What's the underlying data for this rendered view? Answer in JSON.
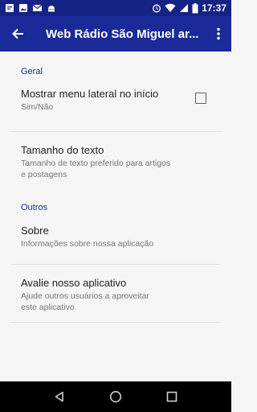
{
  "status_bar": {
    "time": "17:37",
    "left_icons": [
      "notification-icon",
      "image-icon",
      "email-icon",
      "android-icon"
    ],
    "right_icons": [
      "alarm-icon",
      "wifi-icon",
      "signal-icon",
      "battery-icon"
    ]
  },
  "app_bar": {
    "title": "Web Rádio São Miguel ar...",
    "back_icon": "arrow-back-icon",
    "menu_icon": "more-vert-icon"
  },
  "sections": [
    {
      "header": "Geral",
      "items": [
        {
          "title": "Mostrar menu lateral no início",
          "summary": "Sim/Não",
          "has_checkbox": true,
          "checked": false
        },
        {
          "title": "Tamanho do texto",
          "summary_line1": "Tamanho de texto preferido para artigos",
          "summary_line2": "e postagens"
        }
      ]
    },
    {
      "header": "Outros",
      "items": [
        {
          "title": "Sobre",
          "summary": "Informações sobre nossa aplicação"
        },
        {
          "title": "Avalie nosso aplicativo",
          "summary_line1": "Ajude outros usuários a aproveitar",
          "summary_line2": "este aplicativo"
        }
      ]
    }
  ],
  "nav_bar": {
    "icons": [
      "nav-back-icon",
      "nav-home-icon",
      "nav-recents-icon"
    ]
  },
  "colors": {
    "primary": "#1a2a99",
    "primary_dark": "#152384",
    "accent_text": "#1a2a99",
    "background": "#f5f5f5"
  }
}
